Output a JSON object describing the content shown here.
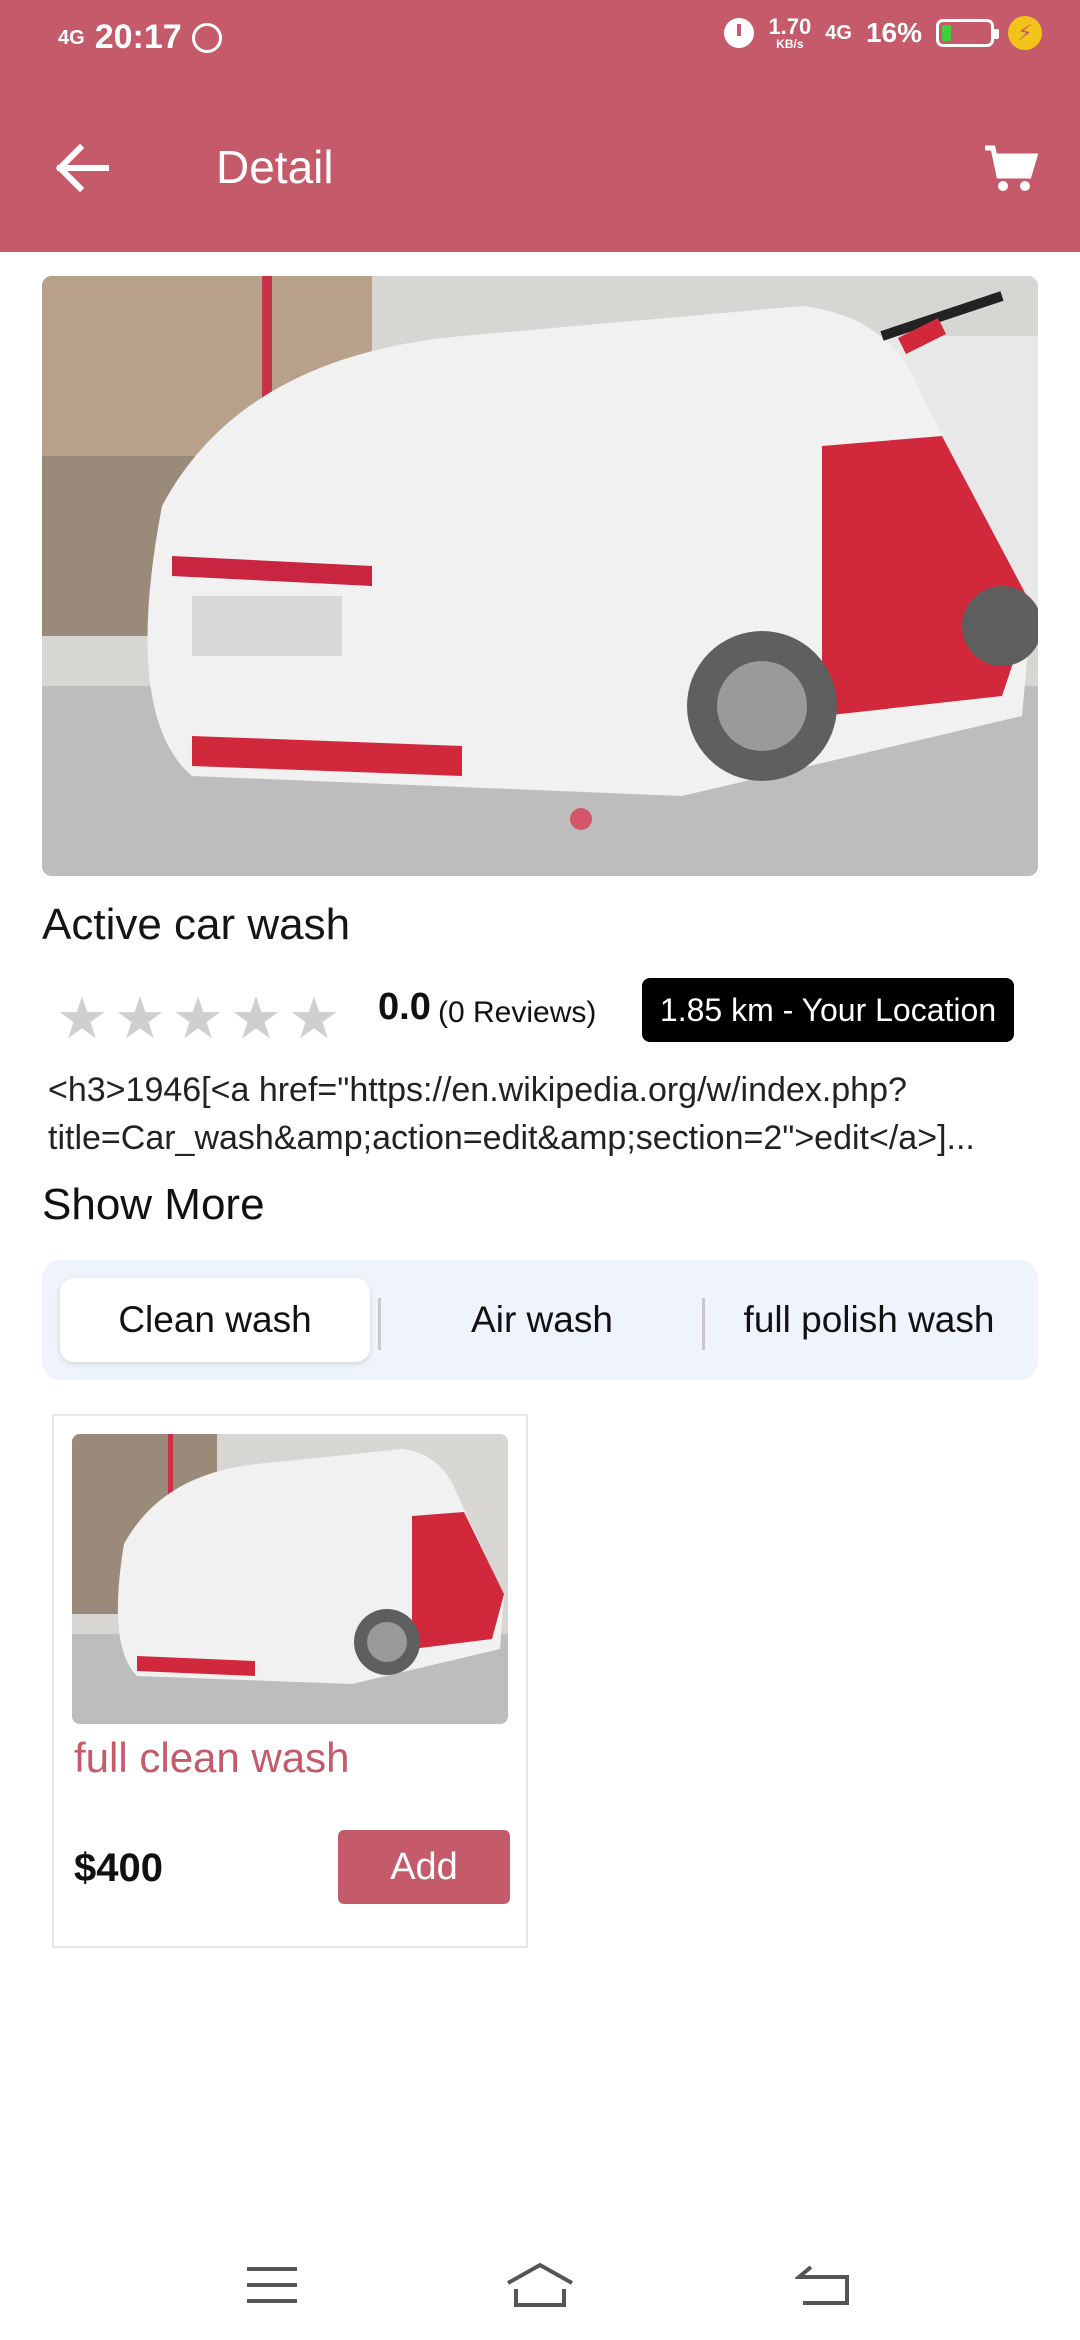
{
  "status_bar": {
    "network": "4G",
    "time": "20:17",
    "speed_value": "1.70",
    "speed_unit": "KB/s",
    "network_right": "4G",
    "battery": "16%",
    "battery_level": 0.16
  },
  "app_bar": {
    "title": "Detail",
    "back_icon": "arrow-left-icon",
    "cart_icon": "cart-icon",
    "color": "#c55a6a"
  },
  "shop": {
    "name": "Active car wash",
    "rating": "0.0",
    "reviews": "(0 Reviews)",
    "star_count": 5,
    "location": "1.85 km - Your Location",
    "description": "<h3>1946[<a href=\"https://en.wikipedia.org/w/index.php?\ntitle=Car_wash&amp;action=edit&amp;section=2\">edit</a>]...",
    "show_more": "Show More"
  },
  "tabs": [
    {
      "label": "Clean wash",
      "active": true
    },
    {
      "label": "Air wash",
      "active": false
    },
    {
      "label": "full polish wash",
      "active": false
    }
  ],
  "services": [
    {
      "name": "full clean wash",
      "price": "$400",
      "action": "Add"
    }
  ],
  "nav": {
    "menu_icon": "menu-icon",
    "home_icon": "home-icon",
    "back_icon": "back-icon"
  }
}
